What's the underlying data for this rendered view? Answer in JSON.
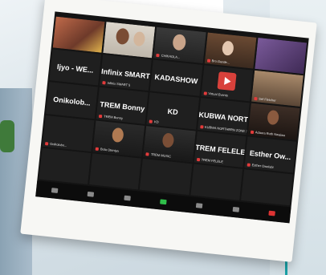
{
  "tiles": [
    {
      "name": "",
      "sub": ""
    },
    {
      "name": "",
      "sub": ""
    },
    {
      "name": "",
      "sub": "CHIKAOLA..."
    },
    {
      "name": "",
      "sub": "Bro.Gentle..."
    },
    {
      "name": "",
      "sub": ""
    },
    {
      "name": "Ijyo - WE...",
      "sub": ""
    },
    {
      "name": "Infinix SMART 5",
      "sub": "Infinix SMART 5"
    },
    {
      "name": "KADASHOW",
      "sub": ""
    },
    {
      "name": "",
      "sub": "Virtual Events"
    },
    {
      "name": "",
      "sub": "Sef Fletcher"
    },
    {
      "name": "Onikolob...",
      "sub": ""
    },
    {
      "name": "TREM Bonny",
      "sub": "TREM Bonny"
    },
    {
      "name": "KD",
      "sub": "KD"
    },
    {
      "name": "KUBWA NORTH...",
      "sub": "KUBWA NORTHERN ZONE 1"
    },
    {
      "name": "",
      "sub": "Adaora Ruth Nwaiwo"
    },
    {
      "name": "",
      "sub": "Onikolobo..."
    },
    {
      "name": "",
      "sub": "Bola Oteniya"
    },
    {
      "name": "",
      "sub": "TREM MUSIC"
    },
    {
      "name": "TREM FELELE",
      "sub": "TREM FELELE"
    },
    {
      "name": "Esther Ow...",
      "sub": "Esther Owolabi"
    },
    {
      "name": "",
      "sub": ""
    },
    {
      "name": "",
      "sub": ""
    },
    {
      "name": "",
      "sub": ""
    },
    {
      "name": "",
      "sub": ""
    },
    {
      "name": "",
      "sub": ""
    }
  ]
}
